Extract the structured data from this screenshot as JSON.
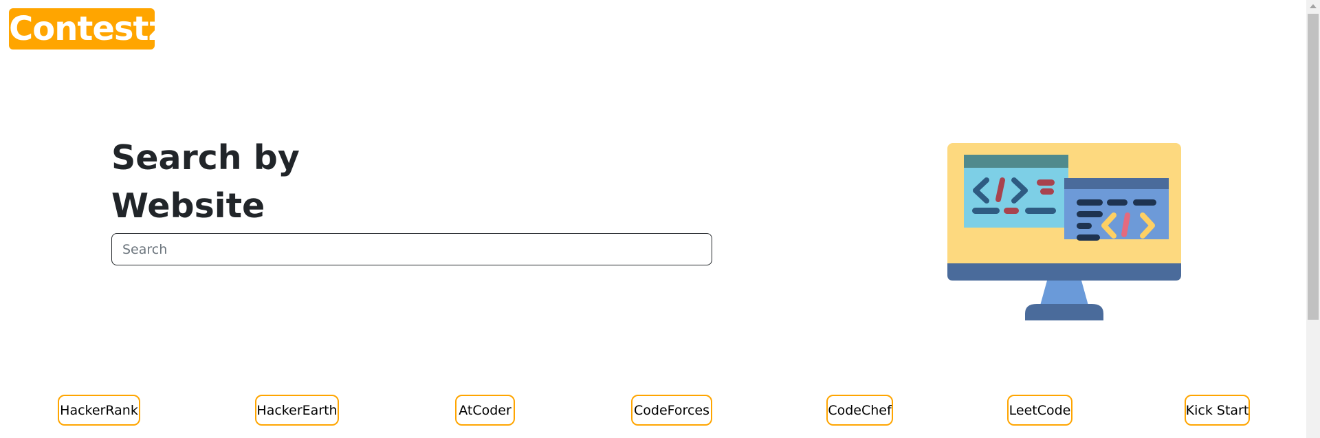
{
  "brand": {
    "logo_text": "Contestz",
    "color": "#ffa500"
  },
  "hero": {
    "title": "Search by Website",
    "search_placeholder": "Search",
    "search_value": ""
  },
  "illustration": {
    "icon": "monitor-code-icon"
  },
  "websites": [
    {
      "label": "HackerRank"
    },
    {
      "label": "HackerEarth"
    },
    {
      "label": "AtCoder"
    },
    {
      "label": "CodeForces"
    },
    {
      "label": "CodeChef"
    },
    {
      "label": "LeetCode"
    },
    {
      "label": "Kick Start"
    }
  ]
}
